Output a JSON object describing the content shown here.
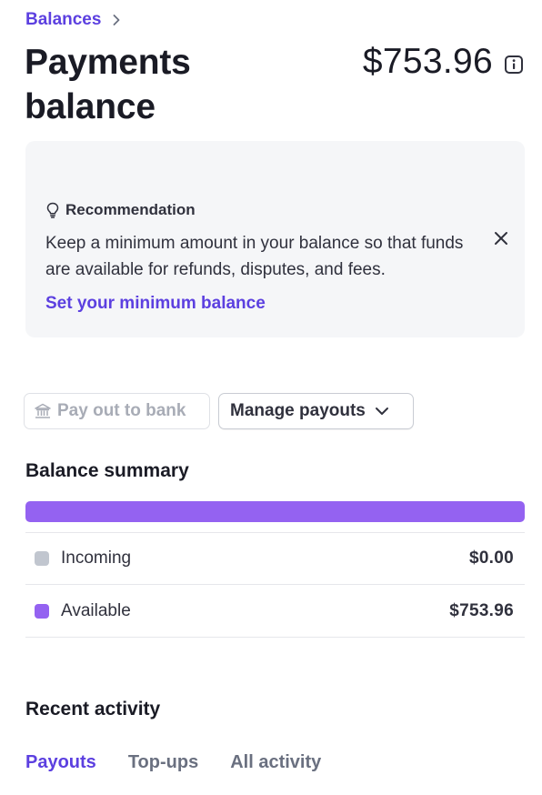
{
  "breadcrumb": {
    "label": "Balances"
  },
  "header": {
    "title": "Payments balance",
    "amount": "$753.96"
  },
  "recommendation": {
    "title": "Recommendation",
    "body": "Keep a minimum amount in your balance so that funds are available for refunds, disputes, and fees.",
    "link": "Set your minimum balance"
  },
  "actions": {
    "pay_out_label": "Pay out to bank",
    "manage_label": "Manage payouts"
  },
  "summary": {
    "title": "Balance summary",
    "bar_color": "#9462f1",
    "rows": [
      {
        "label": "Incoming",
        "value": "$0.00",
        "color": "#c1c6cf"
      },
      {
        "label": "Available",
        "value": "$753.96",
        "color": "#9462f1"
      }
    ]
  },
  "activity": {
    "title": "Recent activity",
    "tabs": [
      {
        "label": "Payouts",
        "active": true
      },
      {
        "label": "Top-ups",
        "active": false
      },
      {
        "label": "All activity",
        "active": false
      }
    ]
  },
  "colors": {
    "accent": "#5c40e0",
    "card_bg": "#f5f6f8"
  }
}
